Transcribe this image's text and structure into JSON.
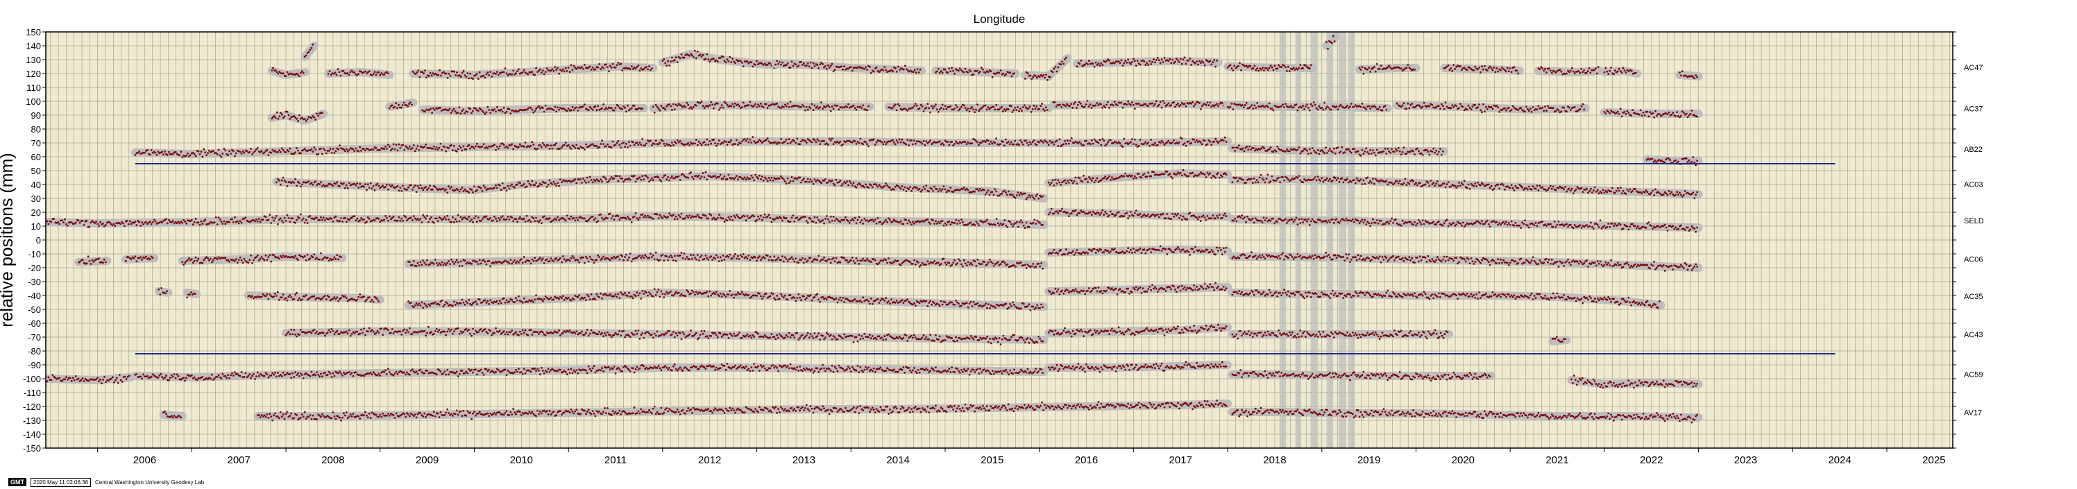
{
  "chart_data": {
    "type": "scatter",
    "title": "Longitude",
    "ylabel": "relative positions (mm)",
    "xlabel": "",
    "xlim": [
      2005.45,
      2025.7
    ],
    "ylim": [
      -150,
      150
    ],
    "y_ticks": [
      150,
      140,
      130,
      120,
      110,
      100,
      90,
      80,
      70,
      60,
      50,
      40,
      30,
      20,
      10,
      0,
      -10,
      -20,
      -30,
      -40,
      -50,
      -60,
      -70,
      -80,
      -90,
      -100,
      -110,
      -120,
      -130,
      -140,
      -150
    ],
    "x_tick_labels": [
      "2006",
      "2007",
      "2008",
      "2009",
      "2010",
      "2011",
      "2012",
      "2013",
      "2014",
      "2015",
      "2016",
      "2017",
      "2018",
      "2019",
      "2020",
      "2021",
      "2022",
      "2023",
      "2024",
      "2025"
    ],
    "grid": true,
    "background_color": "#efe9cf",
    "point_color": "#7a0a0a",
    "band_color": "#bdbdbd",
    "hline_color": "#1f2a8a",
    "horizontal_lines": [
      {
        "y": 55,
        "x_start": 2006.4,
        "x_end": 2024.45
      },
      {
        "y": -82,
        "x_start": 2006.4,
        "x_end": 2024.45
      }
    ],
    "gray_vertical_bands": [
      [
        2018.55,
        2018.62
      ],
      [
        2018.72,
        2018.78
      ],
      [
        2018.88,
        2018.96
      ],
      [
        2019.05,
        2019.12
      ],
      [
        2019.18,
        2019.25
      ],
      [
        2019.28,
        2019.35
      ]
    ],
    "series": [
      {
        "name": "AC47",
        "segments": [
          {
            "x": [
              2007.85,
              2008.0,
              2008.2
            ],
            "y": [
              122,
              119,
              121
            ]
          },
          {
            "x": [
              2008.2,
              2008.3
            ],
            "y": [
              132,
              140
            ]
          },
          {
            "x": [
              2008.45,
              2008.8,
              2009.1
            ],
            "y": [
              120,
              121,
              119
            ]
          },
          {
            "x": [
              2009.35,
              2010.0,
              2010.8,
              2011.5,
              2011.9
            ],
            "y": [
              120,
              119,
              122,
              125,
              124
            ]
          },
          {
            "x": [
              2012.0,
              2012.3,
              2012.6,
              2013.0,
              2013.2
            ],
            "y": [
              128,
              134,
              130,
              127,
              126
            ]
          },
          {
            "x": [
              2013.2,
              2013.6,
              2014.0,
              2014.4,
              2014.75
            ],
            "y": [
              127,
              126,
              124,
              123,
              122
            ]
          },
          {
            "x": [
              2014.9,
              2015.4,
              2015.75
            ],
            "y": [
              122,
              121,
              120
            ]
          },
          {
            "x": [
              2015.85,
              2016.1,
              2016.3
            ],
            "y": [
              119,
              118,
              131
            ]
          },
          {
            "x": [
              2016.4,
              2016.8,
              2017.4,
              2017.9
            ],
            "y": [
              127,
              128,
              129,
              128
            ]
          },
          {
            "x": [
              2018.0,
              2018.5,
              2018.9
            ],
            "y": [
              125,
              124,
              124
            ]
          },
          {
            "x": [
              2019.05,
              2019.15
            ],
            "y": [
              140,
              147
            ]
          },
          {
            "x": [
              2019.4,
              2019.8,
              2020.0
            ],
            "y": [
              123,
              124,
              124
            ]
          },
          {
            "x": [
              2020.3,
              2020.8,
              2021.1
            ],
            "y": [
              124,
              123,
              122
            ]
          },
          {
            "x": [
              2021.3,
              2021.7,
              2021.95
            ],
            "y": [
              122,
              121,
              122
            ]
          },
          {
            "x": [
              2022.0,
              2022.2,
              2022.35
            ],
            "y": [
              121,
              122,
              120
            ]
          },
          {
            "x": [
              2022.8,
              2023.0
            ],
            "y": [
              119,
              118
            ]
          }
        ]
      },
      {
        "name": "AC37",
        "segments": [
          {
            "x": [
              2007.85,
              2008.0,
              2008.2,
              2008.4
            ],
            "y": [
              88,
              90,
              86,
              91
            ]
          },
          {
            "x": [
              2009.1,
              2009.35
            ],
            "y": [
              96,
              99
            ]
          },
          {
            "x": [
              2009.45,
              2010.0,
              2010.5,
              2011.0,
              2011.8
            ],
            "y": [
              94,
              93,
              94,
              95,
              95
            ]
          },
          {
            "x": [
              2011.9,
              2012.3,
              2013.0,
              2013.6,
              2014.2
            ],
            "y": [
              95,
              97,
              97,
              96,
              96
            ]
          },
          {
            "x": [
              2014.4,
              2015.0,
              2015.6,
              2016.1
            ],
            "y": [
              96,
              95,
              95,
              95
            ]
          },
          {
            "x": [
              2016.15,
              2016.8,
              2017.5,
              2018.0
            ],
            "y": [
              97,
              98,
              98,
              97
            ]
          },
          {
            "x": [
              2018.0,
              2018.6,
              2019.2,
              2019.7
            ],
            "y": [
              97,
              96,
              96,
              95
            ]
          },
          {
            "x": [
              2019.8,
              2020.5,
              2021.2,
              2021.8
            ],
            "y": [
              97,
              96,
              94,
              95
            ]
          },
          {
            "x": [
              2022.0,
              2022.5,
              2023.0
            ],
            "y": [
              92,
              91,
              91
            ]
          }
        ]
      },
      {
        "name": "AB22",
        "segments": [
          {
            "x": [
              2006.4,
              2007.0,
              2008.0,
              2009.0,
              2010.0,
              2011.0,
              2012.0,
              2013.0,
              2014.0,
              2015.0,
              2016.0,
              2017.0,
              2018.0
            ],
            "y": [
              63,
              62,
              64,
              66,
              67,
              68,
              70,
              71,
              71,
              70,
              70,
              70,
              71
            ]
          },
          {
            "x": [
              2018.05,
              2018.5,
              2019.0,
              2019.5,
              2020.3
            ],
            "y": [
              66,
              65,
              64,
              64,
              64
            ]
          },
          {
            "x": [
              2022.45,
              2022.8,
              2023.0
            ],
            "y": [
              58,
              57,
              57
            ]
          }
        ]
      },
      {
        "name": "AC03",
        "segments": [
          {
            "x": [
              2007.9,
              2008.5,
              2009.5,
              2010.0,
              2010.5,
              2011.5,
              2012.5,
              2013.5,
              2014.5,
              2015.5,
              2016.05
            ],
            "y": [
              42,
              40,
              37,
              36,
              40,
              44,
              46,
              43,
              38,
              35,
              30
            ]
          },
          {
            "x": [
              2016.1,
              2016.8,
              2017.5,
              2018.0
            ],
            "y": [
              41,
              45,
              48,
              47
            ]
          },
          {
            "x": [
              2018.05,
              2018.6,
              2019.3,
              2020.0,
              2020.8,
              2021.5,
              2022.2,
              2023.0
            ],
            "y": [
              43,
              44,
              43,
              41,
              39,
              37,
              35,
              33
            ]
          }
        ]
      },
      {
        "name": "SELD",
        "segments": [
          {
            "x": [
              2005.45,
              2006.0,
              2007.0,
              2008.0,
              2009.0,
              2010.0,
              2011.0,
              2012.0,
              2013.0,
              2014.0,
              2015.0,
              2016.05
            ],
            "y": [
              13,
              12,
              13,
              15,
              15,
              15,
              15,
              17,
              16,
              14,
              13,
              11
            ]
          },
          {
            "x": [
              2016.1,
              2016.8,
              2017.5,
              2018.0
            ],
            "y": [
              20,
              19,
              17,
              17
            ]
          },
          {
            "x": [
              2018.05,
              2018.6,
              2019.3,
              2020.0,
              2020.8,
              2021.5,
              2022.2,
              2023.0
            ],
            "y": [
              15,
              14,
              14,
              12,
              12,
              11,
              10,
              9
            ]
          }
        ]
      },
      {
        "name": "AC06",
        "segments": [
          {
            "x": [
              2005.8,
              2006.1
            ],
            "y": [
              -16,
              -15
            ]
          },
          {
            "x": [
              2006.3,
              2006.6
            ],
            "y": [
              -14,
              -13
            ]
          },
          {
            "x": [
              2006.9,
              2007.5,
              2008.0,
              2008.6
            ],
            "y": [
              -15,
              -14,
              -12,
              -13
            ]
          },
          {
            "x": [
              2009.3,
              2010.0,
              2011.0,
              2012.0,
              2013.0,
              2014.0,
              2015.0,
              2016.05
            ],
            "y": [
              -17,
              -16,
              -14,
              -12,
              -13,
              -15,
              -16,
              -18
            ]
          },
          {
            "x": [
              2016.1,
              2016.8,
              2017.5,
              2018.0
            ],
            "y": [
              -9,
              -8,
              -7,
              -8
            ]
          },
          {
            "x": [
              2018.05,
              2018.6,
              2019.3,
              2020.0,
              2020.8,
              2021.5,
              2022.2,
              2023.0
            ],
            "y": [
              -12,
              -12,
              -13,
              -14,
              -15,
              -16,
              -18,
              -20
            ]
          }
        ]
      },
      {
        "name": "AC35",
        "segments": [
          {
            "x": [
              2006.65,
              2006.75
            ],
            "y": [
              -37,
              -38
            ]
          },
          {
            "x": [
              2006.95,
              2007.05
            ],
            "y": [
              -38,
              -39
            ]
          },
          {
            "x": [
              2007.6,
              2008.0,
              2008.8,
              2009.0
            ],
            "y": [
              -40,
              -41,
              -42,
              -43
            ]
          },
          {
            "x": [
              2009.3,
              2010.0,
              2011.0,
              2012.0,
              2013.0,
              2014.0,
              2015.0,
              2016.05
            ],
            "y": [
              -47,
              -45,
              -42,
              -38,
              -40,
              -43,
              -46,
              -48
            ]
          },
          {
            "x": [
              2016.1,
              2016.8,
              2017.5,
              2018.0
            ],
            "y": [
              -37,
              -36,
              -35,
              -34
            ]
          },
          {
            "x": [
              2018.05,
              2018.6,
              2019.3,
              2020.0,
              2020.8,
              2021.5,
              2022.2,
              2022.6
            ],
            "y": [
              -38,
              -39,
              -39,
              -40,
              -40,
              -41,
              -44,
              -47
            ]
          }
        ]
      },
      {
        "name": "AC43",
        "segments": [
          {
            "x": [
              2008.0,
              2009.0,
              2010.0,
              2011.0,
              2012.0,
              2013.0,
              2014.0,
              2015.0,
              2016.05
            ],
            "y": [
              -67,
              -66,
              -66,
              -67,
              -68,
              -69,
              -70,
              -71,
              -72
            ]
          },
          {
            "x": [
              2016.1,
              2016.8,
              2017.5,
              2018.0
            ],
            "y": [
              -67,
              -66,
              -65,
              -63
            ]
          },
          {
            "x": [
              2018.05,
              2018.6,
              2019.3,
              2020.0,
              2020.35
            ],
            "y": [
              -68,
              -68,
              -68,
              -68,
              -68
            ]
          },
          {
            "x": [
              2021.45,
              2021.6
            ],
            "y": [
              -73,
              -72
            ]
          }
        ]
      },
      {
        "name": "AC59",
        "segments": [
          {
            "x": [
              2005.45,
              2006.0,
              2006.35
            ],
            "y": [
              -100,
              -101,
              -99
            ]
          },
          {
            "x": [
              2006.4,
              2007.0,
              2008.0,
              2009.0,
              2010.0,
              2011.0,
              2012.0,
              2013.0,
              2014.0,
              2015.0,
              2016.05
            ],
            "y": [
              -98,
              -99,
              -97,
              -96,
              -95,
              -94,
              -92,
              -92,
              -93,
              -94,
              -95
            ]
          },
          {
            "x": [
              2016.1,
              2016.8,
              2017.5,
              2018.0
            ],
            "y": [
              -92,
              -92,
              -91,
              -90
            ]
          },
          {
            "x": [
              2018.05,
              2018.6,
              2019.3,
              2020.0,
              2020.8
            ],
            "y": [
              -97,
              -97,
              -98,
              -98,
              -98
            ]
          },
          {
            "x": [
              2021.65,
              2022.0,
              2022.5,
              2023.0
            ],
            "y": [
              -101,
              -104,
              -103,
              -104
            ]
          }
        ]
      },
      {
        "name": "AV17",
        "segments": [
          {
            "x": [
              2006.7,
              2006.9
            ],
            "y": [
              -126,
              -127
            ]
          },
          {
            "x": [
              2007.7,
              2008.5,
              2009.5,
              2010.5,
              2011.5,
              2012.5,
              2013.5,
              2014.5,
              2015.5,
              2016.5,
              2017.5,
              2018.0
            ],
            "y": [
              -127,
              -127,
              -126,
              -125,
              -124,
              -123,
              -122,
              -122,
              -121,
              -120,
              -119,
              -118
            ]
          },
          {
            "x": [
              2018.05,
              2018.6,
              2019.3,
              2020.0,
              2020.8,
              2021.5,
              2022.2,
              2023.0
            ],
            "y": [
              -124,
              -124,
              -125,
              -125,
              -126,
              -127,
              -127,
              -128
            ]
          }
        ]
      }
    ]
  },
  "footer": {
    "logo": "GMT",
    "timestamp": "2020 May 11 02:06:36",
    "credit": "Central Washington University Geodesy Lab"
  }
}
